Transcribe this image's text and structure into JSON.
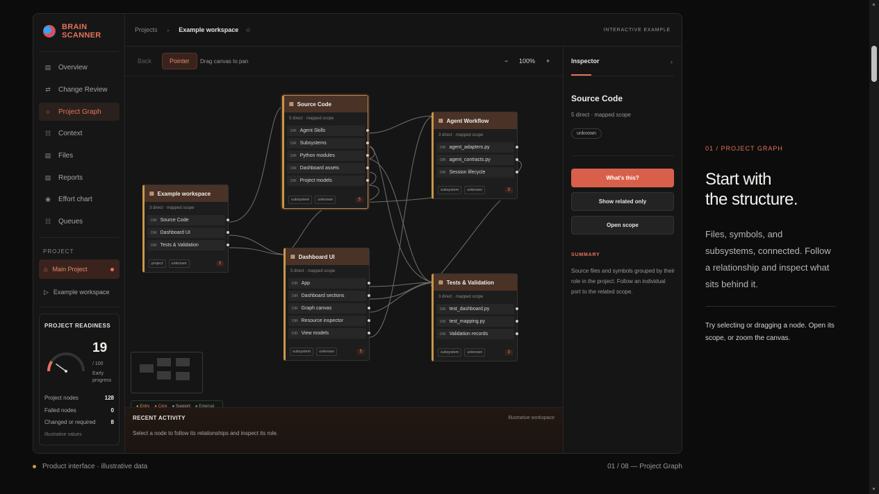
{
  "brand": {
    "line1": "BRAIN",
    "line2": "SCANNER"
  },
  "nav": [
    {
      "icon": "▤",
      "label": "Overview"
    },
    {
      "icon": "⇄",
      "label": "Change Review"
    },
    {
      "icon": "○",
      "label": "Project Graph"
    },
    {
      "icon": "☷",
      "label": "Context"
    },
    {
      "icon": "▤",
      "label": "Files"
    },
    {
      "icon": "▤",
      "label": "Reports"
    },
    {
      "icon": "◉",
      "label": "Effort chart"
    },
    {
      "icon": "☷",
      "label": "Queues"
    }
  ],
  "project": {
    "section": "PROJECT",
    "main": "Main Project",
    "sub": "Example workspace",
    "main_icon": "⌂",
    "sub_icon": "▷"
  },
  "readiness": {
    "title": "PROJECT READINESS",
    "score": "19",
    "of": "/ 100",
    "label1": "Early",
    "label2": "progress",
    "progress": 0.19,
    "stats": [
      {
        "label": "Project nodes",
        "value": "128"
      },
      {
        "label": "Failed nodes",
        "value": "0"
      },
      {
        "label": "Changed or required",
        "value": "8"
      }
    ],
    "note": "Illustrative values"
  },
  "topbar": {
    "crumb": "Projects",
    "current": "Example workspace",
    "badge": "INTERACTIVE EXAMPLE"
  },
  "toolbar": {
    "back": "Back",
    "pointer": "Pointer",
    "hint": "Drag canvas to pan",
    "zoom_out": "−",
    "zoom": "100%",
    "zoom_in": "+"
  },
  "nodes": {
    "source": {
      "title": "Source Code",
      "sub": "5 direct · mapped scope",
      "rows": [
        "Agent Skills",
        "Subsystems",
        "Python modules",
        "Dashboard assets",
        "Project models"
      ],
      "tags": [
        "subsystem",
        "unknown"
      ],
      "count": "5"
    },
    "agent": {
      "title": "Agent Workflow",
      "sub": "3 direct · mapped scope",
      "rows": [
        "agent_adapters.py",
        "agent_contracts.py",
        "Session lifecycle"
      ],
      "tags": [
        "subsystem",
        "unknown"
      ],
      "count": "3"
    },
    "workspace": {
      "title": "Example workspace",
      "sub": "3 direct · mapped scope",
      "rows": [
        "Source Code",
        "Dashboard UI",
        "Tests & Validation"
      ],
      "tags": [
        "project",
        "unknown"
      ],
      "count": "3"
    },
    "dashboard": {
      "title": "Dashboard UI",
      "sub": "5 direct · mapped scope",
      "rows": [
        "App",
        "Dashboard sections",
        "Graph canvas",
        "Resource inspector",
        "View models"
      ],
      "tags": [
        "subsystem",
        "unknown"
      ],
      "count": "5"
    },
    "tests": {
      "title": "Tests & Validation",
      "sub": "3 direct · mapped scope",
      "rows": [
        "test_dashboard.py",
        "test_mapping.py",
        "Validation records"
      ],
      "tags": [
        "subsystem",
        "unknown"
      ],
      "count": "3"
    }
  },
  "dir_label": "DIR",
  "legend": [
    "● Entry",
    "● Core",
    "● Support",
    "● External"
  ],
  "activity": {
    "title": "RECENT ACTIVITY",
    "badge": "Illustrative workspace",
    "text": "Select a node to follow its relationships and inspect its role."
  },
  "inspector": {
    "tab": "Inspector",
    "title": "Source Code",
    "sub": "5 direct · mapped scope",
    "pill": "unknown",
    "btn_primary": "What's this?",
    "btn_related": "Show related only",
    "btn_open": "Open scope",
    "summary_label": "SUMMARY",
    "summary": "Source files and symbols grouped by their role in the project. Follow an individual port to the related scope."
  },
  "hero": {
    "kicker": "01 / PROJECT GRAPH",
    "title1": "Start with",
    "title2": "the structure.",
    "body": "Files, symbols, and subsystems, connected. Follow a relationship and inspect what sits behind it.",
    "hint": "Try selecting or dragging a node. Open its scope, or zoom the canvas."
  },
  "footer": {
    "left": "Product interface · illustrative data",
    "right": "01 / 08 — Project Graph"
  },
  "colors": {
    "accent": "#e5735a",
    "node_border": "#c9974a",
    "primary_button": "#d8604a"
  }
}
